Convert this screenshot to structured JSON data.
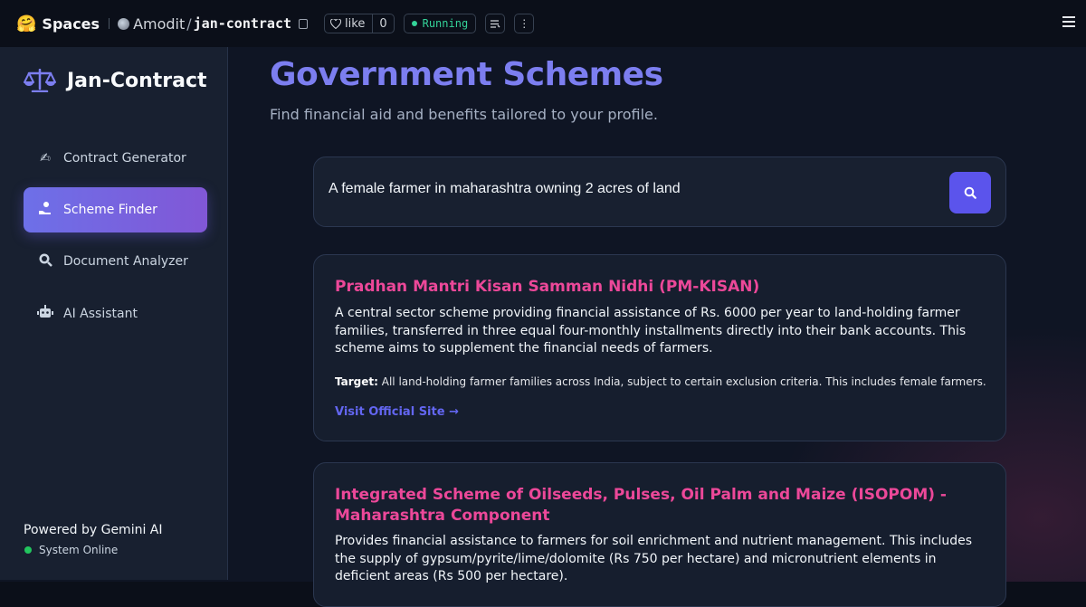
{
  "topbar": {
    "spaces_label": "Spaces",
    "owner": "Amodit",
    "repo": "jan-contract",
    "like_label": "like",
    "like_count": "0",
    "status": "Running"
  },
  "sidebar": {
    "brand": "Jan-Contract",
    "items": [
      {
        "label": "Contract Generator",
        "icon": "pen-icon"
      },
      {
        "label": "Scheme Finder",
        "icon": "hand-money-icon"
      },
      {
        "label": "Document Analyzer",
        "icon": "magnifier-icon"
      },
      {
        "label": "AI Assistant",
        "icon": "robot-icon"
      }
    ],
    "powered_by": "Powered by Gemini AI",
    "system_status": "System Online"
  },
  "main": {
    "title": "Government Schemes",
    "subtitle": "Find financial aid and benefits tailored to your profile.",
    "search": {
      "value": "A female farmer in maharashtra owning 2 acres of land"
    },
    "results": [
      {
        "title": "Pradhan Mantri Kisan Samman Nidhi (PM-KISAN)",
        "description": "A central sector scheme providing financial assistance of Rs. 6000 per year to land-holding farmer families, transferred in three equal four-monthly installments directly into their bank accounts. This scheme aims to supplement the financial needs of farmers.",
        "target_label": "Target:",
        "target": "All land-holding farmer families across India, subject to certain exclusion criteria. This includes female farmers.",
        "link_label": "Visit Official Site →"
      },
      {
        "title": "Integrated Scheme of Oilseeds, Pulses, Oil Palm and Maize (ISOPOM) - Maharashtra Component",
        "description": "Provides financial assistance to farmers for soil enrichment and nutrient management. This includes the supply of gypsum/pyrite/lime/dolomite (Rs 750 per hectare) and micronutrient elements in deficient areas (Rs 500 per hectare)."
      }
    ]
  },
  "colors": {
    "accent": "#7c7ef0",
    "active_nav": "#6d70e8",
    "result_title": "#ec4899",
    "link": "#6366f1",
    "running": "#34d399"
  }
}
